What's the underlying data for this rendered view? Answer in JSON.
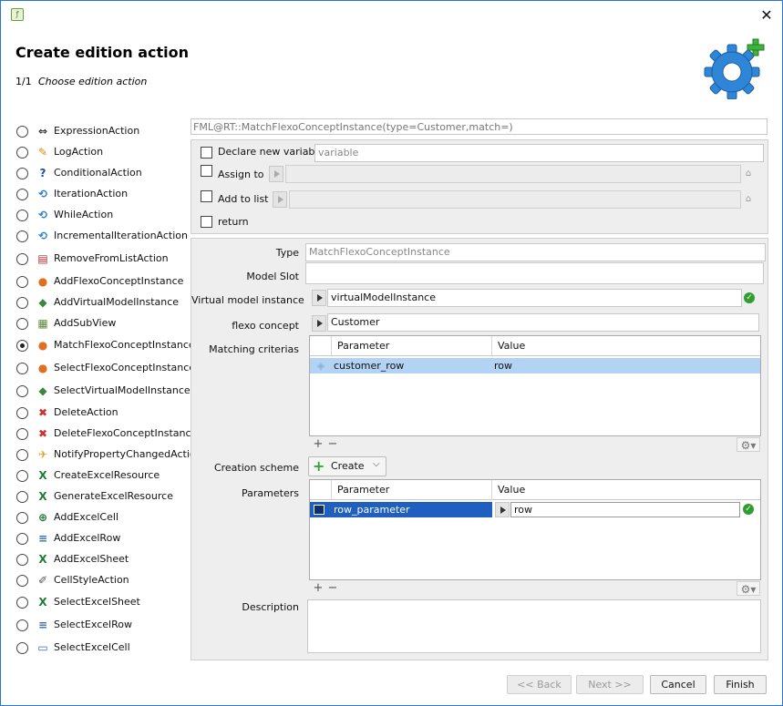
{
  "window": {
    "close_label": "✕"
  },
  "header": {
    "title": "Create edition action",
    "step": "1/1",
    "step_desc": "Choose edition action"
  },
  "actions": [
    {
      "label": "ExpressionAction",
      "icon": "expression-icon",
      "glyph": "⇔",
      "color": "#333"
    },
    {
      "label": "LogAction",
      "icon": "pencil-icon",
      "glyph": "✎",
      "color": "#d98c00"
    },
    {
      "label": "ConditionalAction",
      "icon": "question-icon",
      "glyph": "?",
      "color": "#1a4fb5"
    },
    {
      "label": "IterationAction",
      "icon": "loop-icon",
      "glyph": "⟲",
      "color": "#2f7fd0"
    },
    {
      "label": "WhileAction",
      "icon": "loop-icon",
      "glyph": "⟲",
      "color": "#2f7fd0"
    },
    {
      "label": "IncrementalIterationAction",
      "icon": "loop-icon",
      "glyph": "⟲",
      "color": "#2f7fd0"
    },
    {
      "label": "RemoveFromListAction",
      "icon": "list-remove-icon",
      "glyph": "▤",
      "color": "#b03030"
    },
    {
      "label": "AddFlexoConceptInstance",
      "icon": "concept-add-icon",
      "glyph": "●",
      "color": "#e07020"
    },
    {
      "label": "AddVirtualModelInstance",
      "icon": "vm-add-icon",
      "glyph": "◆",
      "color": "#3a8a3a"
    },
    {
      "label": "AddSubView",
      "icon": "subview-add-icon",
      "glyph": "▦",
      "color": "#5a8a3a"
    },
    {
      "label": "MatchFlexoConceptInstance",
      "icon": "concept-match-icon",
      "glyph": "●",
      "color": "#e07020"
    },
    {
      "label": "SelectFlexoConceptInstance",
      "icon": "concept-select-icon",
      "glyph": "●",
      "color": "#e07020"
    },
    {
      "label": "SelectVirtualModelInstance",
      "icon": "vm-select-icon",
      "glyph": "◆",
      "color": "#3a8a3a"
    },
    {
      "label": "DeleteAction",
      "icon": "delete-icon",
      "glyph": "✖",
      "color": "#d03030"
    },
    {
      "label": "DeleteFlexoConceptInstance",
      "icon": "concept-delete-icon",
      "glyph": "✖",
      "color": "#d03030"
    },
    {
      "label": "NotifyPropertyChangedAction",
      "icon": "notify-icon",
      "glyph": "✈",
      "color": "#e0a020"
    },
    {
      "label": "CreateExcelResource",
      "icon": "excel-icon",
      "glyph": "X",
      "color": "#1e7b34"
    },
    {
      "label": "GenerateExcelResource",
      "icon": "excel-icon",
      "glyph": "X",
      "color": "#1e7b34"
    },
    {
      "label": "AddExcelCell",
      "icon": "excel-cell-icon",
      "glyph": "⊕",
      "color": "#1e7b34"
    },
    {
      "label": "AddExcelRow",
      "icon": "excel-row-icon",
      "glyph": "≡",
      "color": "#3a6ab0"
    },
    {
      "label": "AddExcelSheet",
      "icon": "excel-sheet-icon",
      "glyph": "X",
      "color": "#1e7b34"
    },
    {
      "label": "CellStyleAction",
      "icon": "brush-icon",
      "glyph": "✐",
      "color": "#555"
    },
    {
      "label": "SelectExcelSheet",
      "icon": "excel-select-sheet-icon",
      "glyph": "X",
      "color": "#1e7b34"
    },
    {
      "label": "SelectExcelRow",
      "icon": "excel-select-row-icon",
      "glyph": "≡",
      "color": "#3a6ab0"
    },
    {
      "label": "SelectExcelCell",
      "icon": "excel-select-cell-icon",
      "glyph": "▭",
      "color": "#3a6ab0"
    }
  ],
  "selected_index": 10,
  "fml": "FML@RT::MatchFlexoConceptInstance(type=Customer,match=)",
  "options": {
    "declare_label": "Declare new variable",
    "declare_placeholder": "variable",
    "assign_label": "Assign to",
    "add_list_label": "Add to list",
    "return_label": "return"
  },
  "form": {
    "type_label": "Type",
    "type_value": "MatchFlexoConceptInstance",
    "model_slot_label": "Model Slot",
    "model_slot_value": "",
    "vmi_label": "Virtual model instance",
    "vmi_value": "virtualModelInstance",
    "concept_label": "flexo concept",
    "concept_value": "Customer",
    "criterias_label": "Matching criterias",
    "creation_label": "Creation scheme",
    "creation_value": "Create",
    "parameters_label": "Parameters",
    "description_label": "Description"
  },
  "criterias_table": {
    "headers": [
      "Parameter",
      "Value"
    ],
    "rows": [
      {
        "parameter": "customer_row",
        "value": "row"
      }
    ]
  },
  "parameters_table": {
    "headers": [
      "Parameter",
      "Value"
    ],
    "rows": [
      {
        "parameter": "row_parameter",
        "value": "row"
      }
    ]
  },
  "table_controls": {
    "add": "+",
    "remove": "−",
    "gear": "⚙▾"
  },
  "footer": {
    "back": "<< Back",
    "next": "Next >>",
    "cancel": "Cancel",
    "finish": "Finish"
  },
  "colors": {
    "selection_light": "#b3d3f5",
    "selection_dark": "#1f5fbf",
    "accent_green": "#2e9e2e"
  }
}
